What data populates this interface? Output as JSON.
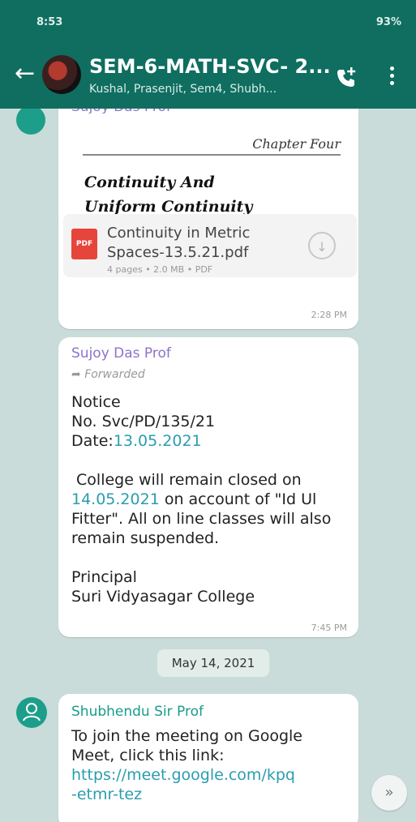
{
  "status_bar": {
    "time": "8:53",
    "right": "93%"
  },
  "header": {
    "title": "SEM-6-MATH-SVC- 2...",
    "subtitle": "Kushal, Prasenjit, Sem4, Shubh...",
    "back_icon": "arrow-left-icon",
    "call_icon": "call-add-icon",
    "menu_icon": "more-vert-icon"
  },
  "messages": [
    {
      "sender": "Sujoy Das Prof",
      "pdf_thumb": {
        "chapter": "Chapter Four",
        "title_line1": "Continuity And",
        "title_line2": "Uniform Continuity"
      },
      "doc": {
        "name_line1": "Continuity in Metric",
        "name_line2": "Spaces-13.5.21.pdf",
        "meta": "4 pages • 2.0 MB • PDF",
        "icon_text": "PDF"
      },
      "time": "2:28 PM"
    },
    {
      "sender": "Sujoy Das Prof",
      "forwarded": "Forwarded",
      "line1": "Notice",
      "line2": "No. Svc/PD/135/21",
      "line3_prefix": "Date:",
      "line3_date": "13.05.2021",
      "para_1": " College will remain closed on",
      "para_2_date": "14.05.2021",
      "para_2_rest": " on account of \"Id Ul",
      "para_3": "Fitter\". All on line classes will also",
      "para_4": "remain suspended.",
      "sign_1": "Principal",
      "sign_2": "Suri Vidyasagar College",
      "time": "7:45 PM"
    },
    {
      "sender": "Shubhendu Sir Prof",
      "line1": "To join the meeting on Google",
      "line2": "Meet, click this link:",
      "link1": "https://meet.google.com/kpq",
      "link2": "-etmr-tez"
    }
  ],
  "date_chip": "May 14, 2021",
  "colors": {
    "header": "#0f6e60",
    "background": "#c9dcd9",
    "sender": "#8c73c9",
    "sender2": "#189b8a",
    "link": "#2a9db0"
  }
}
